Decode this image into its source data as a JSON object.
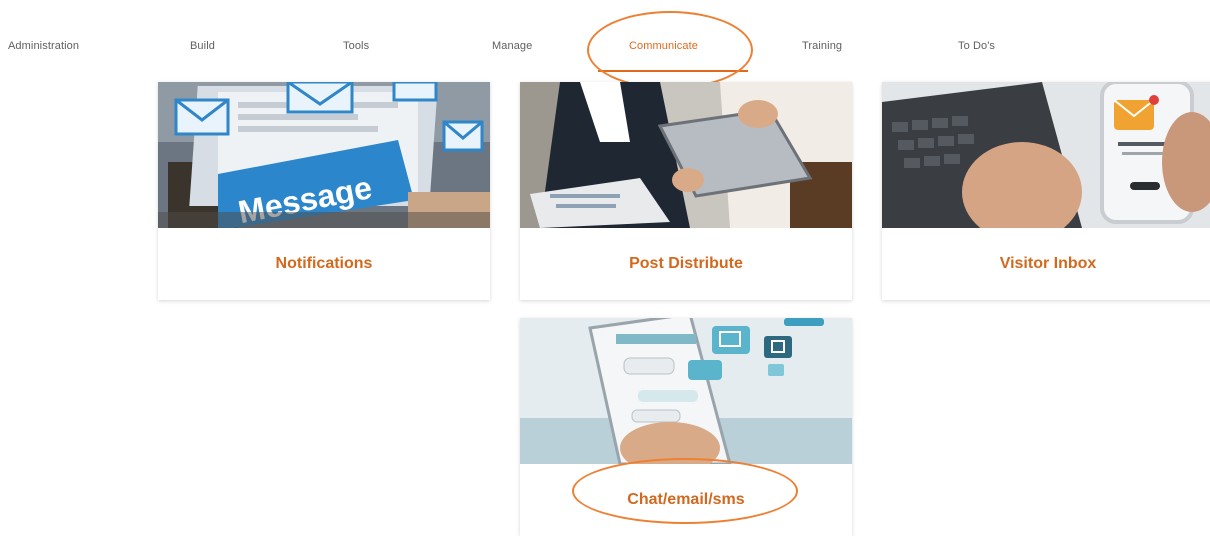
{
  "nav": {
    "items": [
      {
        "label": "Administration",
        "active": false
      },
      {
        "label": "Build",
        "active": false
      },
      {
        "label": "Tools",
        "active": false
      },
      {
        "label": "Manage",
        "active": false
      },
      {
        "label": "Communicate",
        "active": true
      },
      {
        "label": "Training",
        "active": false
      },
      {
        "label": "To Do's",
        "active": false
      }
    ]
  },
  "cards": [
    {
      "title": "Notifications",
      "image_text": "Message",
      "icon": "message-envelope-image"
    },
    {
      "title": "Post Distribute",
      "icon": "tablet-business-image"
    },
    {
      "title": "Visitor Inbox",
      "icon": "phone-laptop-image"
    },
    {
      "title": "Chat/email/sms",
      "icon": "chat-phone-image"
    }
  ],
  "colors": {
    "accent": "#e06a1b",
    "card_title": "#d2691e",
    "annotation": "#ee8034",
    "nav_text": "#5f5f5f"
  }
}
